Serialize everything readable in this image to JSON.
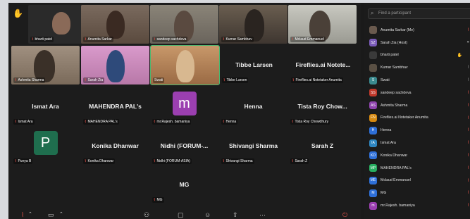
{
  "gallery": {
    "tiles": [
      {
        "id": "bharti",
        "name": "bharti patel",
        "type": "video",
        "bg": "#2a2a2a"
      },
      {
        "id": "anumita",
        "name": "Anumita Sarkar",
        "type": "video",
        "bg": "#6a5a4e"
      },
      {
        "id": "sandeep",
        "name": "sandeep sachdeva",
        "type": "video",
        "bg": "#6e6a64"
      },
      {
        "id": "kumar",
        "name": "Kumar Sambhav",
        "type": "video",
        "bg": "#5a5044"
      },
      {
        "id": "mclaud",
        "name": "Mclaud Emmanuel",
        "type": "video",
        "bg": "#a8a8a0"
      },
      {
        "id": "ashmita",
        "name": "Ashmita Sharma",
        "type": "video",
        "bg": "#8a7868"
      },
      {
        "id": "sarahzia",
        "name": "Sarah Zia",
        "type": "video",
        "bg": "#c98cbe"
      },
      {
        "id": "swati",
        "name": "Swati",
        "type": "video",
        "bg": "#b88a60"
      },
      {
        "id": "tibbe",
        "name": "Tibbe Larsen",
        "big": "Tibbe Larsen",
        "type": "name"
      },
      {
        "id": "fireflies",
        "name": "Fireflies.ai Notetaker Anumita",
        "big": "Fireflies.ai Notete...",
        "type": "name"
      },
      {
        "id": "ismat",
        "name": "Ismat Ara",
        "big": "Ismat Ara",
        "type": "name"
      },
      {
        "id": "mahendra",
        "name": "MAHENDRA PAL's",
        "big": "MAHENDRA PAL's",
        "type": "name"
      },
      {
        "id": "rajesh",
        "name": "mr.Rajesh. bamaniya",
        "avatar": "m",
        "avatar_color": "#9b3fb0",
        "type": "avatar"
      },
      {
        "id": "henna",
        "name": "Henna",
        "big": "Henna",
        "type": "name"
      },
      {
        "id": "tista",
        "name": "Tista Roy Chowdhury",
        "big": "Tista Roy Chow...",
        "type": "name"
      },
      {
        "id": "punya",
        "name": "Punya B",
        "avatar": "P",
        "avatar_color": "#1f6e4e",
        "type": "avatar"
      },
      {
        "id": "konika",
        "name": "Konika Dhanwar",
        "big": "Konika Dhanwar",
        "type": "name"
      },
      {
        "id": "nidhi",
        "name": "Nidhi (FORUM-ASIA)",
        "big": "Nidhi (FORUM-...",
        "type": "name"
      },
      {
        "id": "shivangi",
        "name": "Shivangi Sharma",
        "big": "Shivangi Sharma",
        "type": "name"
      },
      {
        "id": "sarahz",
        "name": "Sarah Z",
        "big": "Sarah Z",
        "type": "name"
      },
      {
        "id": "mg",
        "name": "MG",
        "big": "MG",
        "type": "name"
      }
    ]
  },
  "panel": {
    "search_placeholder": "Find a participant",
    "participants": [
      {
        "name": "Anumita Sarkar (Me)",
        "initials": "",
        "color": "#6a5a4e",
        "photo": true,
        "status": "mic-off"
      },
      {
        "name": "Sarah Zia (Host)",
        "initials": "SZ",
        "color": "#7a5bb8",
        "status": "mic-on"
      },
      {
        "name": "bharti patel",
        "initials": "",
        "color": "#3a3a3a",
        "photo": true,
        "status": "hand"
      },
      {
        "name": "Kumar Sambhav",
        "initials": "",
        "color": "#5a5044",
        "photo": true,
        "status": "mic-on"
      },
      {
        "name": "Swati",
        "initials": "S",
        "color": "#3b8a8f",
        "status": "mic-on"
      },
      {
        "name": "sandeep sachdeva",
        "initials": "SS",
        "color": "#c0392b",
        "status": "mic-off"
      },
      {
        "name": "Ashmita Sharma",
        "initials": "AS",
        "color": "#8e44ad",
        "status": "mic-off"
      },
      {
        "name": "Fireflies.ai Notetaker Anumita",
        "initials": "FN",
        "color": "#d68910",
        "status": "mic-off"
      },
      {
        "name": "Henna",
        "initials": "H",
        "color": "#2e6fd8",
        "status": "mic-off"
      },
      {
        "name": "Ismat Ara",
        "initials": "IA",
        "color": "#2e86c1",
        "status": "mic-off"
      },
      {
        "name": "Konika Dhanwar",
        "initials": "KD",
        "color": "#2e6fd8",
        "status": "mic-off"
      },
      {
        "name": "MAHENDRA PAL's",
        "initials": "MP",
        "color": "#27ae60",
        "status": "mic-off"
      },
      {
        "name": "Mclaud Emmanuel",
        "initials": "ME",
        "color": "#2e6fd8",
        "status": "mic-off"
      },
      {
        "name": "MG",
        "initials": "M",
        "color": "#2e6fd8",
        "status": "mic-off"
      },
      {
        "name": "mr.Rajesh. bamaniya",
        "initials": "m",
        "color": "#9b3fb0",
        "status": "mic-off"
      }
    ]
  }
}
